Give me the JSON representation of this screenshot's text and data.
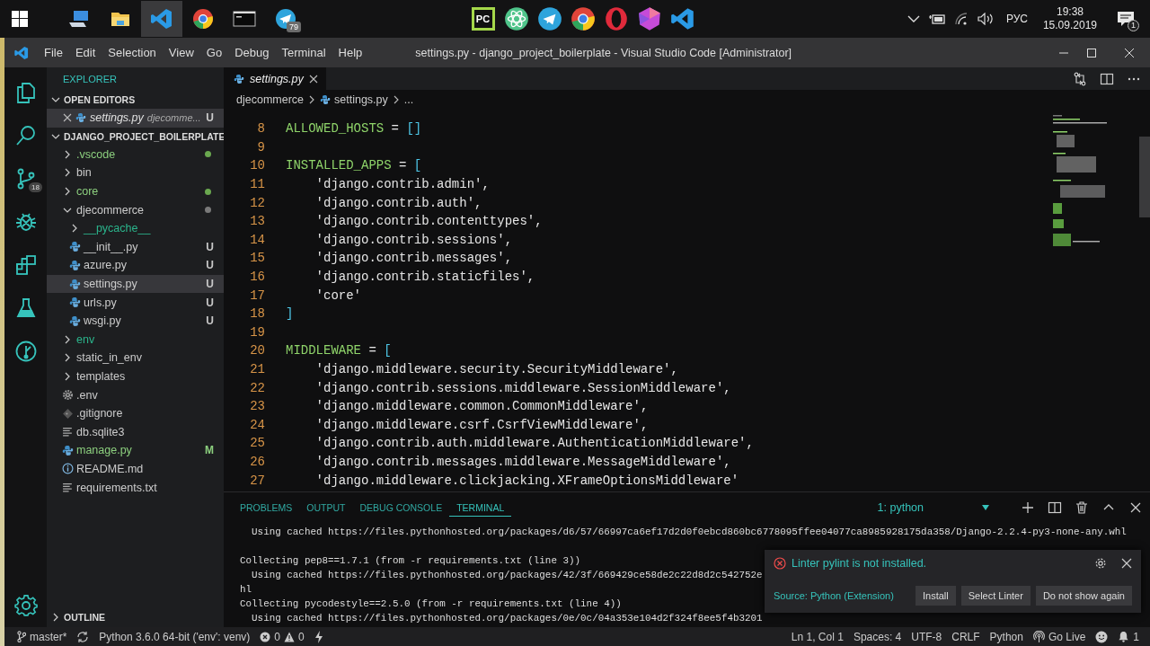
{
  "taskbar": {
    "pinned": [
      {
        "kind": "computer",
        "selected": false
      },
      {
        "kind": "folder",
        "selected": false
      },
      {
        "kind": "vscode",
        "selected": true
      },
      {
        "kind": "chrome",
        "selected": false
      },
      {
        "kind": "terminal",
        "selected": false
      },
      {
        "kind": "telegram",
        "selected": false,
        "badge": "79"
      }
    ],
    "center": [
      {
        "kind": "pycharm",
        "label": "PC"
      },
      {
        "kind": "atom"
      },
      {
        "kind": "telegram"
      },
      {
        "kind": "chrome"
      },
      {
        "kind": "opera"
      },
      {
        "kind": "gem"
      },
      {
        "kind": "vscode"
      }
    ],
    "tray": {
      "language": "РУС",
      "time": "19:38",
      "date": "15.09.2019",
      "notifications": "1"
    }
  },
  "window": {
    "title": "settings.py - django_project_boilerplate - Visual Studio Code [Administrator]",
    "menu": [
      "File",
      "Edit",
      "Selection",
      "View",
      "Go",
      "Debug",
      "Terminal",
      "Help"
    ]
  },
  "activity_bar": {
    "items": [
      {
        "kind": "explorer"
      },
      {
        "kind": "search"
      },
      {
        "kind": "source_control",
        "badge": "18"
      },
      {
        "kind": "debug"
      },
      {
        "kind": "extensions"
      },
      {
        "kind": "test"
      },
      {
        "kind": "git_graph"
      }
    ]
  },
  "explorer": {
    "title": "EXPLORER",
    "open_editors": {
      "title": "OPEN EDITORS",
      "expanded": true,
      "items": [
        {
          "name": "settings.py",
          "description": "djecomme...",
          "status": "U",
          "selected": true
        }
      ]
    },
    "project": {
      "title": "DJANGO_PROJECT_BOILERPLATE",
      "expanded": true,
      "items": [
        {
          "name": ".vscode",
          "kind": "folder",
          "expanded": false,
          "selected": false,
          "color": "#8ccf7e",
          "decoration": {
            "kind": "dot",
            "color": "#6aa84f"
          }
        },
        {
          "name": "bin",
          "kind": "folder",
          "expanded": false,
          "selected": false,
          "color": "#cccccc"
        },
        {
          "name": "core",
          "kind": "folder",
          "expanded": false,
          "selected": false,
          "color": "#8ccf7e",
          "decoration": {
            "kind": "dot",
            "color": "#6aa84f"
          }
        },
        {
          "name": "djecommerce",
          "kind": "folder",
          "expanded": true,
          "selected": false,
          "color": "#cccccc",
          "decoration": {
            "kind": "dot",
            "color": "#7a7a7a"
          },
          "children": [
            {
              "name": "__pycache__",
              "kind": "folder",
              "expanded": false,
              "selected": false,
              "color": "#2bb58c"
            },
            {
              "name": "__init__.py",
              "kind": "python_file",
              "selected": false,
              "color": "#cccccc",
              "decoration": {
                "kind": "letter",
                "text": "U",
                "color": "#c8c8c8"
              }
            },
            {
              "name": "azure.py",
              "kind": "python_file",
              "selected": false,
              "color": "#cccccc",
              "decoration": {
                "kind": "letter",
                "text": "U",
                "color": "#c8c8c8"
              }
            },
            {
              "name": "settings.py",
              "kind": "python_file",
              "selected": true,
              "color": "#cccccc",
              "decoration": {
                "kind": "letter",
                "text": "U",
                "color": "#c8c8c8"
              }
            },
            {
              "name": "urls.py",
              "kind": "python_file",
              "selected": false,
              "color": "#cccccc",
              "decoration": {
                "kind": "letter",
                "text": "U",
                "color": "#c8c8c8"
              }
            },
            {
              "name": "wsgi.py",
              "kind": "python_file",
              "selected": false,
              "color": "#cccccc",
              "decoration": {
                "kind": "letter",
                "text": "U",
                "color": "#c8c8c8"
              }
            }
          ]
        },
        {
          "name": "env",
          "kind": "folder",
          "expanded": false,
          "selected": false,
          "color": "#2bb58c"
        },
        {
          "name": "static_in_env",
          "kind": "folder",
          "expanded": false,
          "selected": false,
          "color": "#cccccc"
        },
        {
          "name": "templates",
          "kind": "folder",
          "expanded": false,
          "selected": false,
          "color": "#cccccc"
        },
        {
          "name": ".env",
          "kind": "config_file",
          "selected": false,
          "color": "#cccccc"
        },
        {
          "name": ".gitignore",
          "kind": "ignore_file",
          "selected": false,
          "color": "#cccccc"
        },
        {
          "name": "db.sqlite3",
          "kind": "text_file",
          "selected": false,
          "color": "#cccccc"
        },
        {
          "name": "manage.py",
          "kind": "python_file",
          "selected": false,
          "color": "#8ccf7e",
          "decoration": {
            "kind": "letter",
            "text": "M",
            "color": "#8ccf7e"
          }
        },
        {
          "name": "README.md",
          "kind": "readme_file",
          "selected": false,
          "color": "#cccccc"
        },
        {
          "name": "requirements.txt",
          "kind": "text_file",
          "selected": false,
          "color": "#cccccc"
        }
      ]
    },
    "outline": {
      "title": "OUTLINE",
      "expanded": false
    }
  },
  "editor": {
    "tabs": [
      {
        "label": "settings.py",
        "selected": true
      }
    ],
    "breadcrumbs": [
      "djecommerce",
      "settings.py",
      "..."
    ],
    "lines": [
      {
        "number": "8",
        "tokens": [
          {
            "kind": "name",
            "text": "ALLOWED_HOSTS"
          },
          {
            "kind": "op",
            "text": " = "
          },
          {
            "kind": "bracket",
            "text": "[]"
          }
        ]
      },
      {
        "number": "9"
      },
      {
        "number": "10",
        "tokens": [
          {
            "kind": "name",
            "text": "INSTALLED_APPS"
          },
          {
            "kind": "op",
            "text": " = "
          },
          {
            "kind": "bracket",
            "text": "["
          }
        ]
      },
      {
        "number": "11",
        "tokens": [
          {
            "kind": "string",
            "text": "    'django.contrib.admin'"
          },
          {
            "kind": "op",
            "text": ","
          }
        ]
      },
      {
        "number": "12",
        "tokens": [
          {
            "kind": "string",
            "text": "    'django.contrib.auth'"
          },
          {
            "kind": "op",
            "text": ","
          }
        ]
      },
      {
        "number": "13",
        "tokens": [
          {
            "kind": "string",
            "text": "    'django.contrib.contenttypes'"
          },
          {
            "kind": "op",
            "text": ","
          }
        ]
      },
      {
        "number": "14",
        "tokens": [
          {
            "kind": "string",
            "text": "    'django.contrib.sessions'"
          },
          {
            "kind": "op",
            "text": ","
          }
        ]
      },
      {
        "number": "15",
        "tokens": [
          {
            "kind": "string",
            "text": "    'django.contrib.messages'"
          },
          {
            "kind": "op",
            "text": ","
          }
        ]
      },
      {
        "number": "16",
        "tokens": [
          {
            "kind": "string",
            "text": "    'django.contrib.staticfiles'"
          },
          {
            "kind": "op",
            "text": ","
          }
        ]
      },
      {
        "number": "17",
        "tokens": [
          {
            "kind": "string",
            "text": "    'core'"
          }
        ]
      },
      {
        "number": "18",
        "tokens": [
          {
            "kind": "bracket",
            "text": "]"
          }
        ]
      },
      {
        "number": "19"
      },
      {
        "number": "20",
        "tokens": [
          {
            "kind": "name",
            "text": "MIDDLEWARE"
          },
          {
            "kind": "op",
            "text": " = "
          },
          {
            "kind": "bracket",
            "text": "["
          }
        ]
      },
      {
        "number": "21",
        "tokens": [
          {
            "kind": "string",
            "text": "    'django.middleware.security.SecurityMiddleware'"
          },
          {
            "kind": "op",
            "text": ","
          }
        ]
      },
      {
        "number": "22",
        "tokens": [
          {
            "kind": "string",
            "text": "    'django.contrib.sessions.middleware.SessionMiddleware'"
          },
          {
            "kind": "op",
            "text": ","
          }
        ]
      },
      {
        "number": "23",
        "tokens": [
          {
            "kind": "string",
            "text": "    'django.middleware.common.CommonMiddleware'"
          },
          {
            "kind": "op",
            "text": ","
          }
        ]
      },
      {
        "number": "24",
        "tokens": [
          {
            "kind": "string",
            "text": "    'django.middleware.csrf.CsrfViewMiddleware'"
          },
          {
            "kind": "op",
            "text": ","
          }
        ]
      },
      {
        "number": "25",
        "tokens": [
          {
            "kind": "string",
            "text": "    'django.contrib.auth.middleware.AuthenticationMiddleware'"
          },
          {
            "kind": "op",
            "text": ","
          }
        ]
      },
      {
        "number": "26",
        "tokens": [
          {
            "kind": "string",
            "text": "    'django.contrib.messages.middleware.MessageMiddleware'"
          },
          {
            "kind": "op",
            "text": ","
          }
        ]
      },
      {
        "number": "27",
        "tokens": [
          {
            "kind": "string",
            "text": "    'django.middleware.clickjacking.XFrameOptionsMiddleware'"
          }
        ]
      }
    ]
  },
  "panel": {
    "tabs": [
      {
        "label": "PROBLEMS",
        "selected": false
      },
      {
        "label": "OUTPUT",
        "selected": false
      },
      {
        "label": "DEBUG CONSOLE",
        "selected": false
      },
      {
        "label": "TERMINAL",
        "selected": true
      }
    ],
    "terminal_select": "1: python",
    "terminal_lines": [
      {
        "text": "  Using cached https://files.pythonhosted.org/packages/d6/57/66997ca6ef17d2d0f0ebcd860bc6778095ffee04077ca8985928175da358/Django-2.2.4-py3-none-any.whl",
        "spaced": false
      },
      {
        "text": "Collecting pep8==1.7.1 (from -r requirements.txt (line 3))",
        "spaced": true
      },
      {
        "text": "  Using cached https://files.pythonhosted.org/packages/42/3f/669429ce58de2c22d8d2c542752e",
        "spaced": false
      },
      {
        "text": "hl",
        "spaced": false
      },
      {
        "text": "Collecting pycodestyle==2.5.0 (from -r requirements.txt (line 4))",
        "spaced": false
      },
      {
        "text": "  Using cached https://files.pythonhosted.org/packages/0e/0c/04a353e104d2f324f8ee5f4b3201",
        "spaced": false
      }
    ]
  },
  "notification": {
    "message": "Linter pylint is not installed.",
    "source": "Source: Python (Extension)",
    "buttons": [
      "Install",
      "Select Linter",
      "Do not show again"
    ]
  },
  "status_bar": {
    "branch": "master*",
    "interpreter": "Python 3.6.0 64-bit ('env': venv)",
    "errors": "0",
    "warnings": "0",
    "right": [
      "Ln 1, Col 1",
      "Spaces: 4",
      "UTF-8",
      "CRLF",
      "Python"
    ],
    "live": "Go Live",
    "bell": "1"
  }
}
